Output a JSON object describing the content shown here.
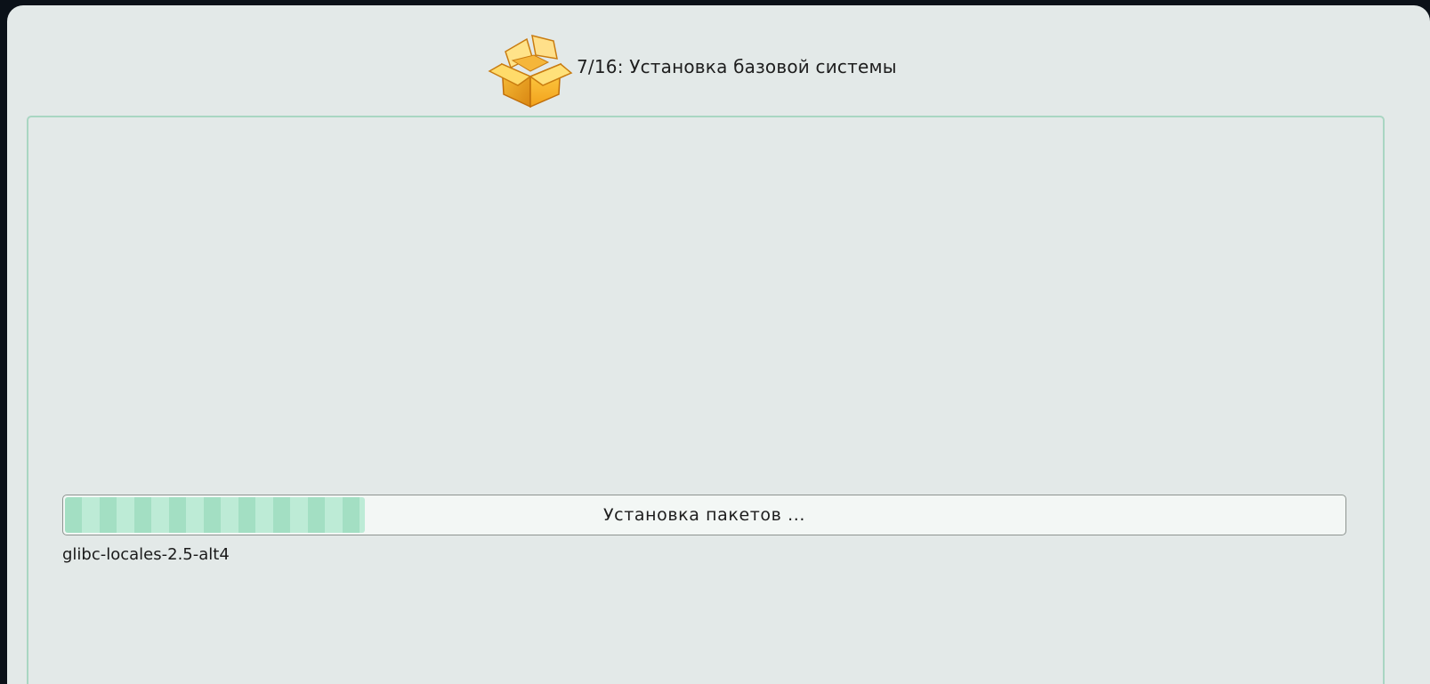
{
  "header": {
    "step_title": "7/16: Установка базовой системы",
    "icon": "package-box-icon"
  },
  "progress": {
    "label": "Установка пакетов ...",
    "percent": 23.4
  },
  "current_package": "glibc-locales-2.5-alt4",
  "colors": {
    "background": "#e3e9e8",
    "panel_border": "#a9d6c2",
    "progress_fill": "#a3dfc3"
  }
}
